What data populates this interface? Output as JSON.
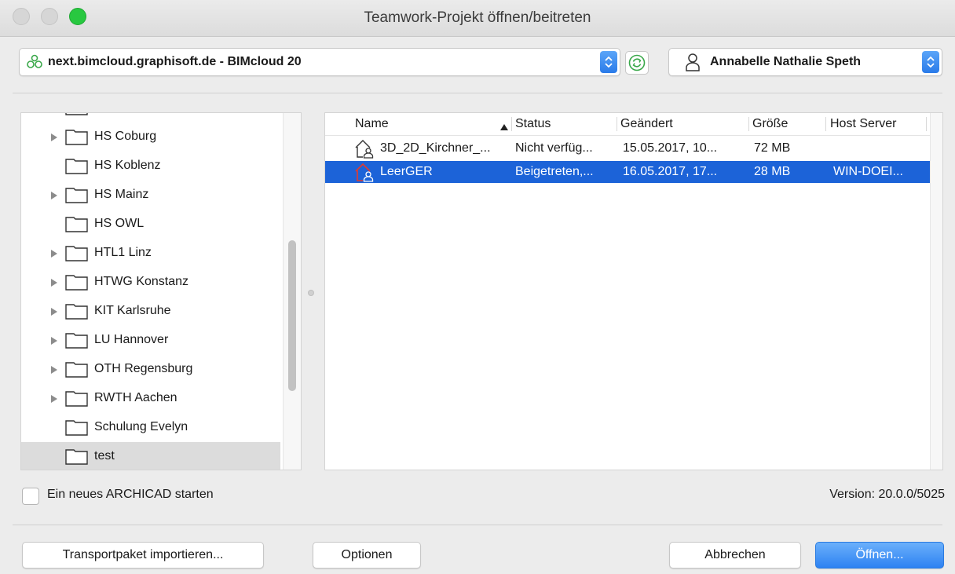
{
  "window": {
    "title": "Teamwork-Projekt öffnen/beitreten"
  },
  "server": {
    "label": "next.bimcloud.graphisoft.de - BIMcloud 20"
  },
  "user": {
    "name": "Annabelle Nathalie Speth"
  },
  "tree": {
    "items": [
      {
        "label": "HS Coburg",
        "expandable": true
      },
      {
        "label": "HS Koblenz",
        "expandable": false
      },
      {
        "label": "HS Mainz",
        "expandable": true
      },
      {
        "label": "HS OWL",
        "expandable": false
      },
      {
        "label": "HTL1 Linz",
        "expandable": true
      },
      {
        "label": "HTWG Konstanz",
        "expandable": true
      },
      {
        "label": "KIT Karlsruhe",
        "expandable": true
      },
      {
        "label": "LU Hannover",
        "expandable": true
      },
      {
        "label": "OTH Regensburg",
        "expandable": true
      },
      {
        "label": "RWTH Aachen",
        "expandable": true
      },
      {
        "label": "Schulung Evelyn",
        "expandable": false
      },
      {
        "label": "test",
        "expandable": false,
        "selected": true
      }
    ]
  },
  "files": {
    "columns": {
      "name": "Name",
      "status": "Status",
      "changed": "Geändert",
      "size": "Größe",
      "host": "Host Server"
    },
    "rows": [
      {
        "name": "3D_2D_Kirchner_...",
        "status": "Nicht verfüg...",
        "changed": "15.05.2017, 10...",
        "size": "72 MB",
        "host": "",
        "selected": false
      },
      {
        "name": "LeerGER",
        "status": "Beigetreten,...",
        "changed": "16.05.2017, 17...",
        "size": "28 MB",
        "host": "WIN-DOEI...",
        "selected": true
      }
    ]
  },
  "footer": {
    "checkbox_label": "Ein neues ARCHICAD starten",
    "version": "Version: 20.0.0/5025",
    "import_button": "Transportpaket importieren...",
    "options_button": "Optionen",
    "cancel_button": "Abbrechen",
    "open_button": "Öffnen..."
  },
  "colors": {
    "accent": "#1c63d8",
    "primary_button": "#2d82f2",
    "server_icon": "#3aa84a"
  }
}
